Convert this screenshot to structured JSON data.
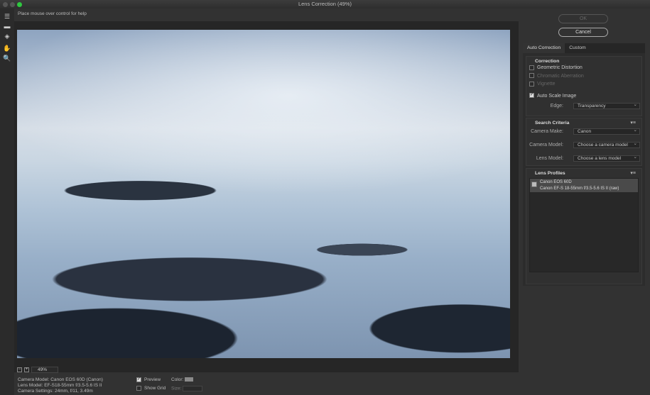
{
  "window": {
    "title": "Lens Correction (49%)",
    "traffic_lights": [
      "#5c5c5c",
      "#5c5c5c",
      "#2fc840"
    ]
  },
  "toolbar": {
    "tools": [
      "remove-distortion-icon",
      "straighten-icon",
      "move-grid-icon",
      "hand-icon",
      "zoom-icon"
    ]
  },
  "help_text": "Place mouse over control for help",
  "buttons": {
    "ok": "OK",
    "cancel": "Cancel"
  },
  "tabs": [
    "Auto Correction",
    "Custom"
  ],
  "correction": {
    "title": "Correction",
    "geometric": "Geometric Distortion",
    "chromatic": "Chromatic Aberration",
    "vignette": "Vignette",
    "auto_scale": "Auto Scale Image",
    "auto_scale_checked": true,
    "edge_label": "Edge:",
    "edge_value": "Transparency"
  },
  "search": {
    "title": "Search Criteria",
    "make_label": "Camera Make:",
    "make_value": "Canon",
    "model_label": "Camera Model:",
    "model_value": "Choose a camera model",
    "lens_label": "Lens Model:",
    "lens_value": "Choose a lens model"
  },
  "profiles": {
    "title": "Lens Profiles",
    "items": [
      {
        "camera": "Canon EOS 60D",
        "lens": "Canon EF-S 18-55mm f/3.5-5.6 IS II (raw)"
      }
    ]
  },
  "zoom": {
    "value": "49%"
  },
  "info": {
    "camera": "Camera Model: Canon EOS 60D (Canon)",
    "lens": "Lens Model: EF-S18-55mm f/3.5-5.6 IS II",
    "settings": "Camera Settings: 24mm, f/11, 3.49m"
  },
  "options": {
    "preview": "Preview",
    "preview_checked": true,
    "show_grid": "Show Grid",
    "color_label": "Color:",
    "grid_color": "#8a8a8a",
    "size_label": "Size:"
  }
}
